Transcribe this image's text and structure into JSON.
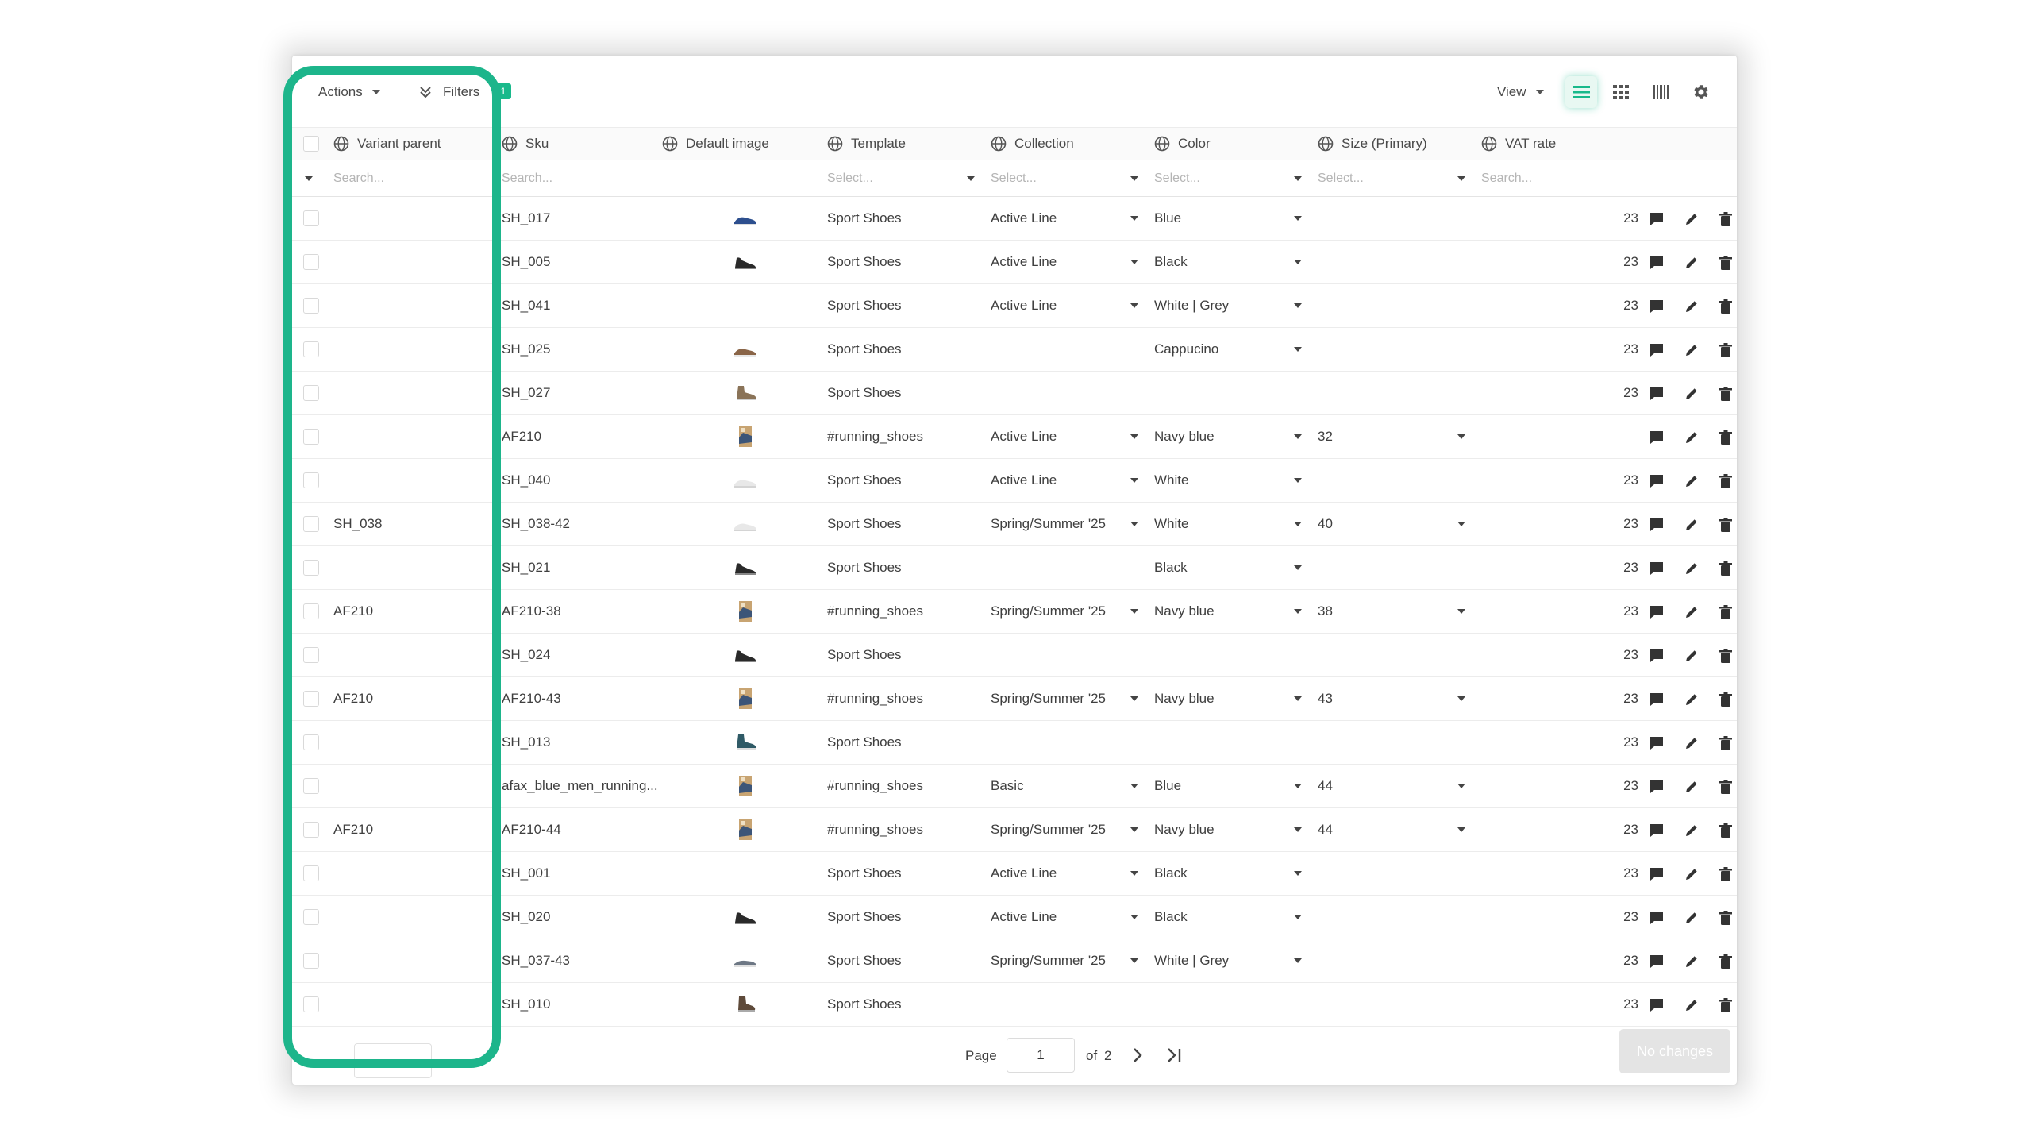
{
  "toolbar": {
    "actions_label": "Actions",
    "filters_label": "Filters",
    "filters_count": "1",
    "view_label": "View",
    "view_modes": [
      "list-view-icon",
      "grid-view-icon",
      "barcode-view-icon"
    ],
    "settings_icon": "gear-icon",
    "accent_color": "#19b98b"
  },
  "columns": [
    {
      "key": "variant_parent",
      "label": "Variant parent"
    },
    {
      "key": "sku",
      "label": "Sku"
    },
    {
      "key": "image",
      "label": "Default image"
    },
    {
      "key": "template",
      "label": "Template"
    },
    {
      "key": "collection",
      "label": "Collection"
    },
    {
      "key": "color",
      "label": "Color"
    },
    {
      "key": "size",
      "label": "Size (Primary)"
    },
    {
      "key": "vat",
      "label": "VAT rate"
    }
  ],
  "filters": {
    "variant_parent": "Search...",
    "sku": "Search...",
    "template": "Select...",
    "collection": "Select...",
    "color": "Select...",
    "size": "Select...",
    "vat": "Search..."
  },
  "rows": [
    {
      "parent": "",
      "sku": "SH_017",
      "image": "blue-sneaker",
      "template": "Sport Shoes",
      "collection": "Active Line",
      "color": "Blue",
      "size": "",
      "vat": "23"
    },
    {
      "parent": "",
      "sku": "SH_005",
      "image": "black-sneaker",
      "template": "Sport Shoes",
      "collection": "Active Line",
      "color": "Black",
      "size": "",
      "vat": "23"
    },
    {
      "parent": "",
      "sku": "SH_041",
      "image": "",
      "template": "Sport Shoes",
      "collection": "Active Line",
      "color": "White | Grey",
      "size": "",
      "vat": "23"
    },
    {
      "parent": "",
      "sku": "SH_025",
      "image": "brown-sneaker",
      "template": "Sport Shoes",
      "collection": "",
      "color": "Cappucino",
      "size": "",
      "vat": "23"
    },
    {
      "parent": "",
      "sku": "SH_027",
      "image": "tan-boot",
      "template": "Sport Shoes",
      "collection": "",
      "color": "",
      "size": "",
      "vat": "23"
    },
    {
      "parent": "",
      "sku": "AF210",
      "image": "running-shoe-box",
      "template": "#running_shoes",
      "collection": "Active Line",
      "color": "Navy blue",
      "size": "32",
      "vat": ""
    },
    {
      "parent": "",
      "sku": "SH_040",
      "image": "white-sneaker",
      "template": "Sport Shoes",
      "collection": "Active Line",
      "color": "White",
      "size": "",
      "vat": "23"
    },
    {
      "parent": "SH_038",
      "sku": "SH_038-42",
      "image": "white-sneaker",
      "template": "Sport Shoes",
      "collection": "Spring/Summer '25",
      "color": "White",
      "size": "40",
      "vat": "23"
    },
    {
      "parent": "",
      "sku": "SH_021",
      "image": "black-sneaker",
      "template": "Sport Shoes",
      "collection": "",
      "color": "Black",
      "size": "",
      "vat": "23"
    },
    {
      "parent": "AF210",
      "sku": "AF210-38",
      "image": "running-shoe-box",
      "template": "#running_shoes",
      "collection": "Spring/Summer '25",
      "color": "Navy blue",
      "size": "38",
      "vat": "23"
    },
    {
      "parent": "",
      "sku": "SH_024",
      "image": "black-sneaker",
      "template": "Sport Shoes",
      "collection": "",
      "color": "",
      "size": "",
      "vat": "23"
    },
    {
      "parent": "AF210",
      "sku": "AF210-43",
      "image": "running-shoe-box",
      "template": "#running_shoes",
      "collection": "Spring/Summer '25",
      "color": "Navy blue",
      "size": "43",
      "vat": "23"
    },
    {
      "parent": "",
      "sku": "SH_013",
      "image": "teal-boot",
      "template": "Sport Shoes",
      "collection": "",
      "color": "",
      "size": "",
      "vat": "23"
    },
    {
      "parent": "",
      "sku": "afax_blue_men_running...",
      "image": "running-shoe-box",
      "template": "#running_shoes",
      "collection": "Basic",
      "color": "Blue",
      "size": "44",
      "vat": "23"
    },
    {
      "parent": "AF210",
      "sku": "AF210-44",
      "image": "running-shoe-box",
      "template": "#running_shoes",
      "collection": "Spring/Summer '25",
      "color": "Navy blue",
      "size": "44",
      "vat": "23"
    },
    {
      "parent": "",
      "sku": "SH_001",
      "image": "",
      "template": "Sport Shoes",
      "collection": "Active Line",
      "color": "Black",
      "size": "",
      "vat": "23"
    },
    {
      "parent": "",
      "sku": "SH_020",
      "image": "black-sneaker",
      "template": "Sport Shoes",
      "collection": "Active Line",
      "color": "Black",
      "size": "",
      "vat": "23"
    },
    {
      "parent": "",
      "sku": "SH_037-43",
      "image": "grey-sneaker",
      "template": "Sport Shoes",
      "collection": "Spring/Summer '25",
      "color": "White | Grey",
      "size": "",
      "vat": "23"
    },
    {
      "parent": "",
      "sku": "SH_010",
      "image": "brown-boot",
      "template": "Sport Shoes",
      "collection": "",
      "color": "",
      "size": "",
      "vat": "23"
    }
  ],
  "row_actions": [
    "comment-icon",
    "edit-icon",
    "delete-icon"
  ],
  "footer": {
    "page_label": "Page",
    "page_value": "1",
    "of_label": "of",
    "total_pages": "2",
    "no_changes_label": "No changes"
  },
  "highlight_color": "#1db58b"
}
